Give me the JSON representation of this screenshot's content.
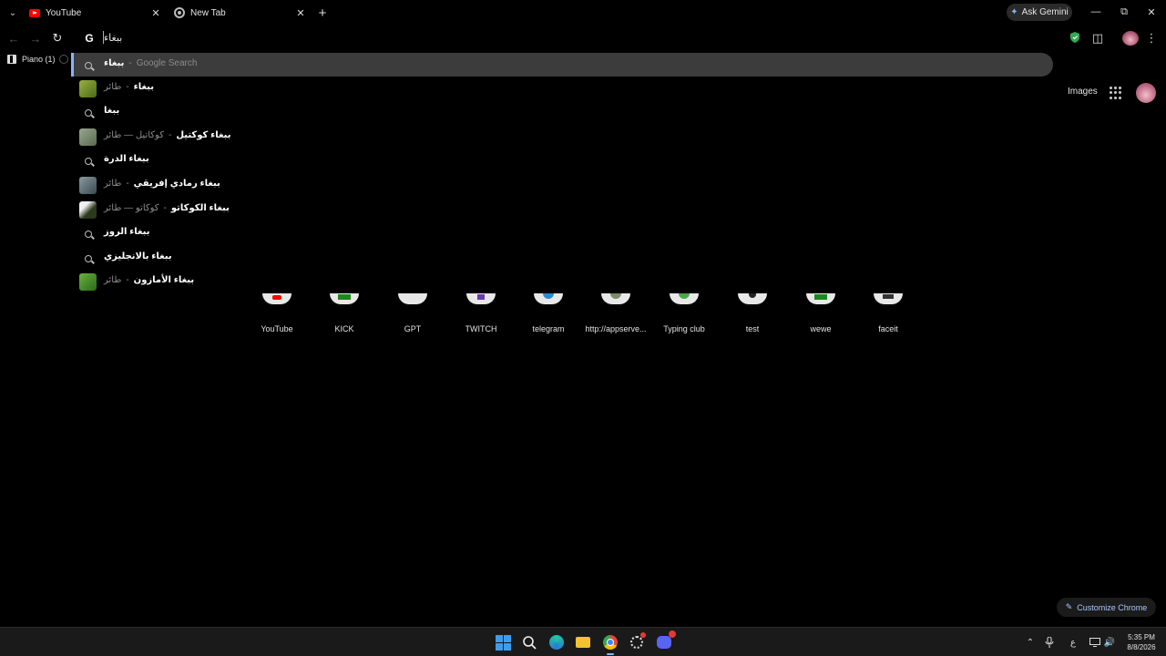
{
  "browser": {
    "tabs": [
      {
        "title": "YouTube",
        "favicon": "youtube-icon"
      },
      {
        "title": "New Tab",
        "favicon": "chrome-icon"
      }
    ],
    "ask_gemini": "Ask Gemini"
  },
  "omnibox": {
    "value": "ببغاء"
  },
  "bookmarks": [
    {
      "label": "Piano (1)"
    }
  ],
  "suggestions": [
    {
      "query": "ببغاء",
      "sep": "-",
      "detail": "Google Search",
      "type": "search"
    },
    {
      "query": "ببغاء",
      "sep": "-",
      "detail": "طائر",
      "type": "entity",
      "thumb": "#6b8f2a"
    },
    {
      "query": "ببغا",
      "sep": "",
      "detail": "",
      "type": "search"
    },
    {
      "query": "ببغاء كوكتيل",
      "sep": "-",
      "detail": "كوكاتيل — طائر",
      "type": "entity",
      "thumb": "#7a8a70"
    },
    {
      "query": "ببغاء الدرة",
      "sep": "",
      "detail": "",
      "type": "search"
    },
    {
      "query": "ببغاء رمادي إفريقي",
      "sep": "-",
      "detail": "طائر",
      "type": "entity",
      "thumb": "#5a6a70"
    },
    {
      "query": "ببغاء الكوكاتو",
      "sep": "-",
      "detail": "كوكاتو — طائر",
      "type": "entity",
      "thumb": "#3a4a2a"
    },
    {
      "query": "ببغاء الروز",
      "sep": "",
      "detail": "",
      "type": "search"
    },
    {
      "query": "ببغاء بالانجليزي",
      "sep": "",
      "detail": "",
      "type": "search"
    },
    {
      "query": "ببغاء الأمازون",
      "sep": "-",
      "detail": "طائر",
      "type": "entity",
      "thumb": "#4a8a30"
    }
  ],
  "ntp": {
    "images_link": "Images",
    "shortcuts": [
      "YouTube",
      "KICK",
      "GPT",
      "TWITCH",
      "telegram",
      "http://appserve...",
      "Typing club",
      "test",
      "wewe",
      "faceit"
    ],
    "customize": "Customize Chrome"
  },
  "taskbar": {
    "time": "5:35 PM",
    "date": "8/8/2026",
    "lang": "ع"
  }
}
